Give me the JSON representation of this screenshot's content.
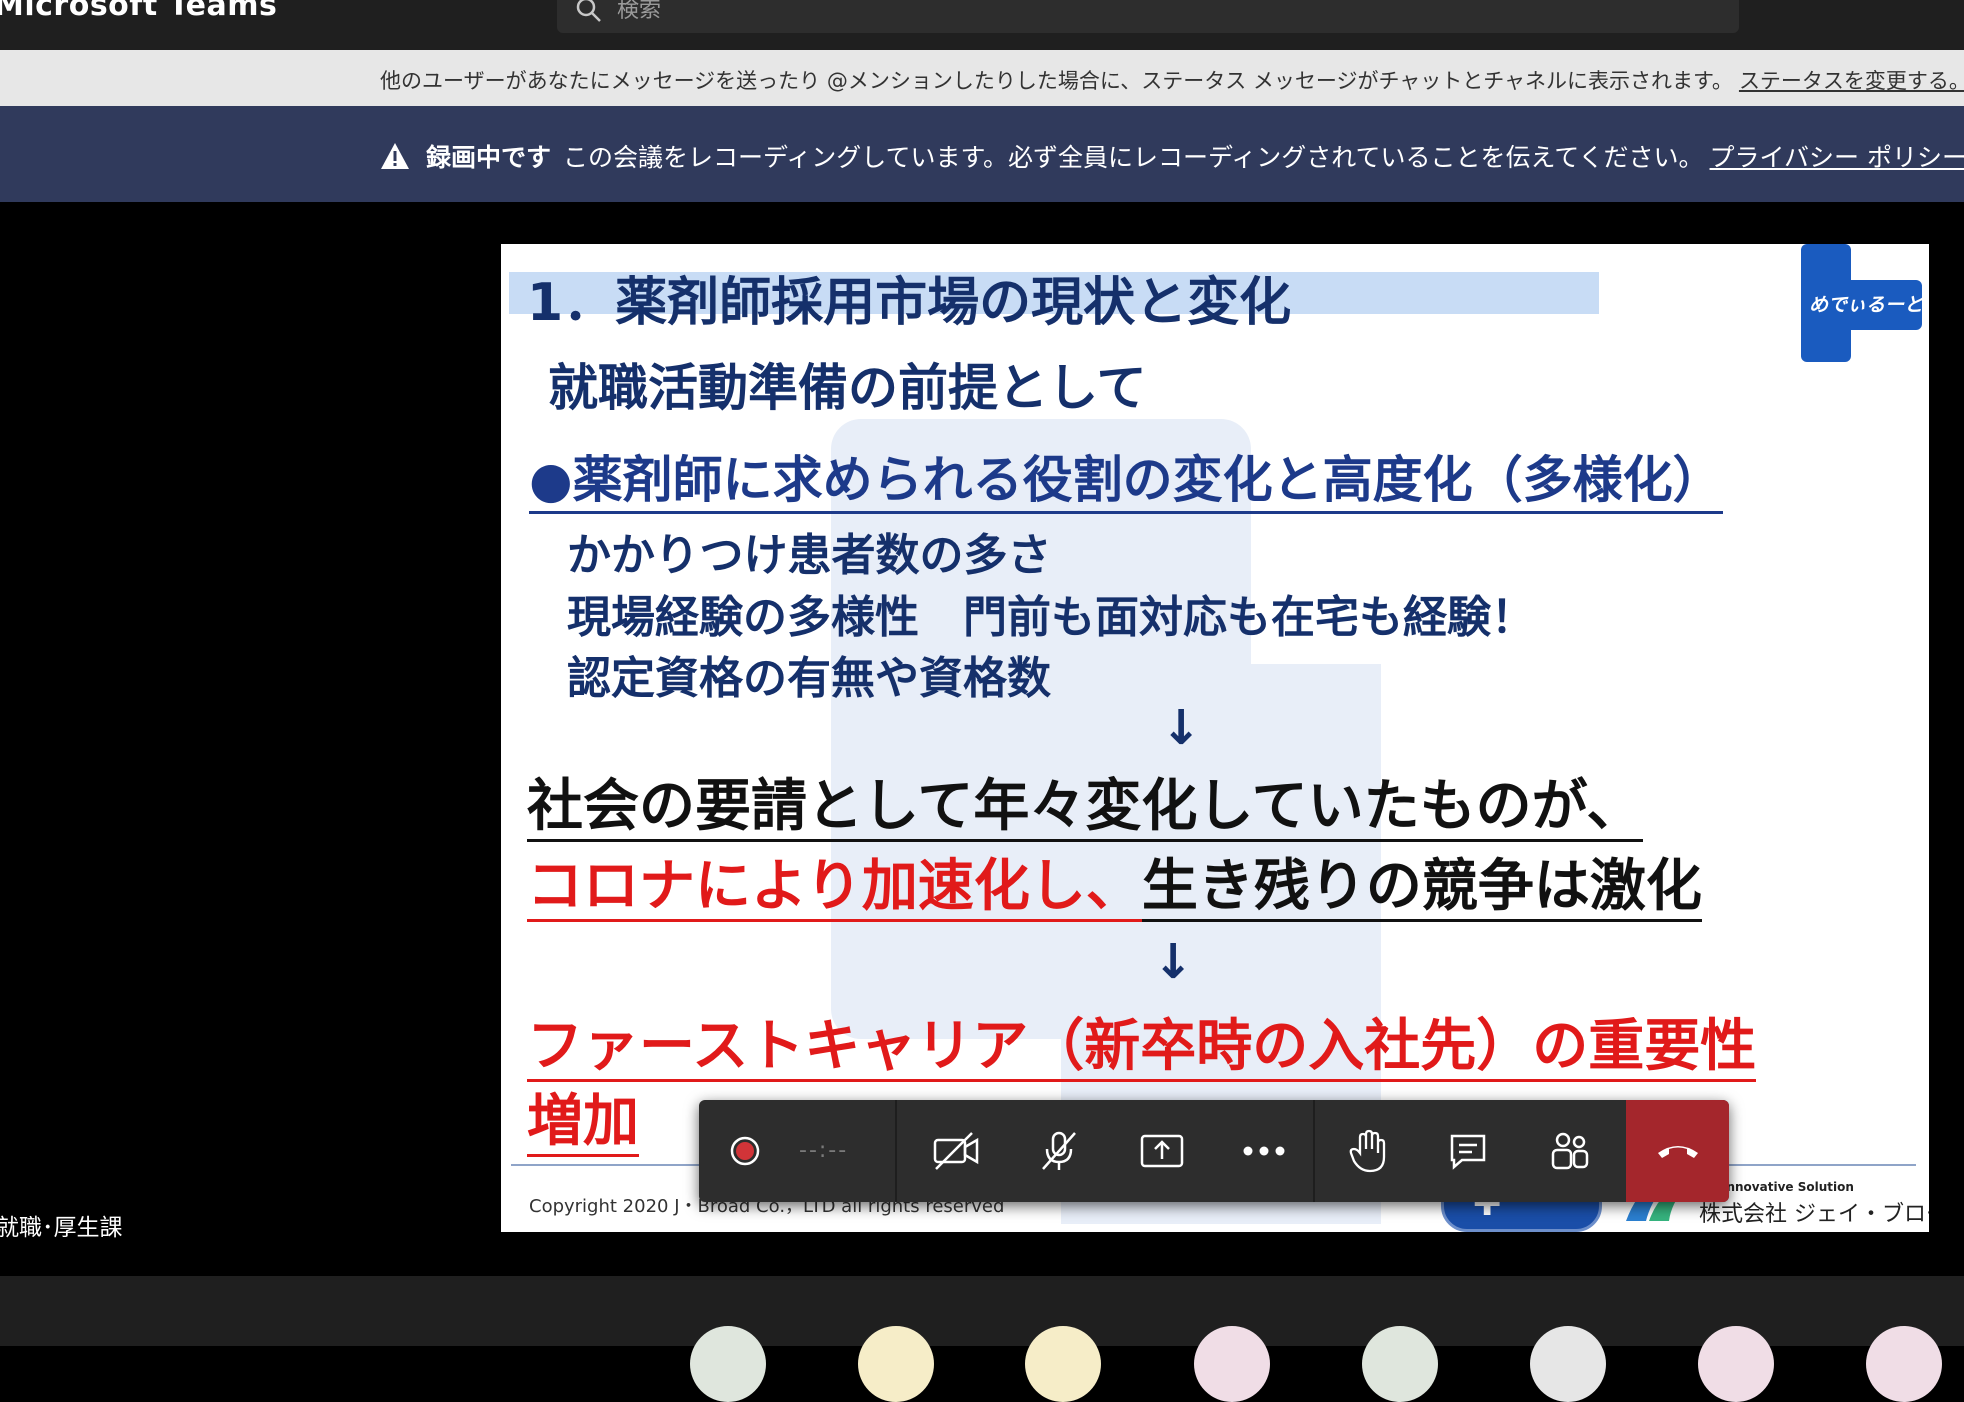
{
  "app": {
    "title": "Microsoft Teams"
  },
  "search": {
    "placeholder": "検索"
  },
  "status_bar": {
    "message": "他のユーザーがあなたにメッセージを送ったり @メンションしたりした場合に、ステータス メッセージがチャットとチャネルに表示されます。",
    "link": "ステータスを変更する。"
  },
  "recording_banner": {
    "label": "録画中です",
    "message": "この会議をレコーディングしています。必ず全員にレコーディングされていることを伝えてください。",
    "link": "プライバシー ポリシー"
  },
  "slide": {
    "title": "1．薬剤師採用市場の現状と変化",
    "logo_text": "めでぃるーと",
    "subtitle": "就職活動準備の前提として",
    "heading": "●薬剤師に求められる役割の変化と高度化（多様化）",
    "points": [
      "かかりつけ患者数の多さ",
      "現場経験の多様性　門前も面対応も在宅も経験！",
      "認定資格の有無や資格数"
    ],
    "arrow": "↓",
    "line1": "社会の要請として年々変化していたものが、",
    "line2_red": "コロナにより加速化し、",
    "line2_black": "生き残りの競争は激化",
    "line3": "ファーストキャリア（新卒時の入社先）の重要性",
    "line4": "増加",
    "copyright": "Copyright 2020 J・Broad Co.，LTD  all rights reserved",
    "company_tag": "企業にInnovative Solution",
    "company_name": "株式会社 ジェイ・ブロード"
  },
  "participant": {
    "name": "就職･厚生課"
  },
  "controls": {
    "timer": "--:--",
    "accent_hangup": "#a4262c"
  },
  "colors": {
    "banner_bg": "#303a5c",
    "slide_title": "#15306b",
    "slide_red": "#e11a1a"
  }
}
